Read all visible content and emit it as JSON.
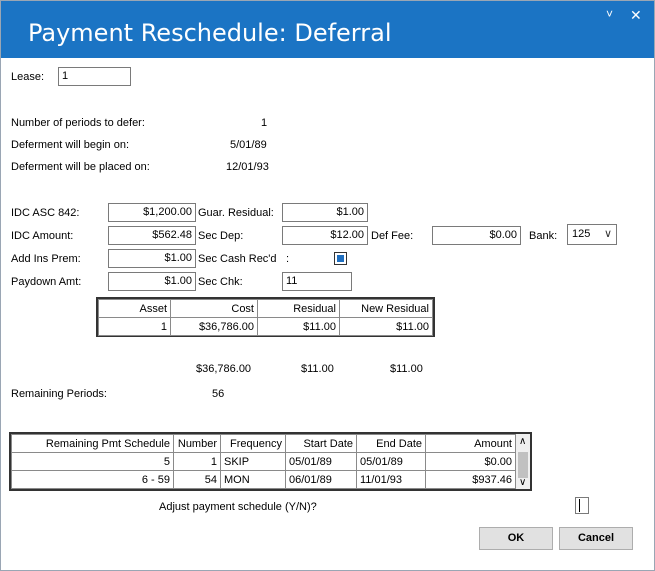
{
  "window": {
    "title": "Payment Reschedule: Deferral",
    "restore_glyph": "˅",
    "close_glyph": "✕"
  },
  "lease": {
    "label": "Lease:",
    "value": "1"
  },
  "info": {
    "periods_label": "Number of periods to defer:",
    "periods_value": "1",
    "begin_label": "Deferment will begin on:",
    "begin_value": "5/01/89",
    "placed_label": "Deferment will be placed on:",
    "placed_value": "12/01/93"
  },
  "fields": {
    "idc_asc_label": "IDC ASC 842:",
    "idc_asc_value": "$1,200.00",
    "idc_amount_label": "IDC Amount:",
    "idc_amount_value": "$562.48",
    "add_ins_label": "Add Ins Prem:",
    "add_ins_value": "$1.00",
    "paydown_label": "Paydown Amt:",
    "paydown_value": "$1.00",
    "guar_label": "Guar. Residual:",
    "guar_value": "$1.00",
    "sec_dep_label": "Sec Dep:",
    "sec_dep_value": "$12.00",
    "sec_cash_label": "Sec Cash Rec'd",
    "sec_cash_colon": ":",
    "sec_chk_label": "Sec Chk:",
    "sec_chk_value": "11",
    "def_fee_label": "Def Fee:",
    "def_fee_value": "$0.00",
    "bank_label": "Bank:",
    "bank_value": "125",
    "bank_chevron": "∨"
  },
  "asset_table": {
    "headers": [
      "Asset",
      "Cost",
      "Residual",
      "New Residual"
    ],
    "rows": [
      [
        "1",
        "$36,786.00",
        "$11.00",
        "$11.00"
      ]
    ]
  },
  "totals": {
    "cost": "$36,786.00",
    "residual": "$11.00",
    "new_residual": "$11.00"
  },
  "remaining": {
    "label": "Remaining Periods:",
    "value": "56"
  },
  "schedule_table": {
    "headers": [
      "Remaining Pmt Schedule",
      "Number",
      "Frequency",
      "Start Date",
      "End Date",
      "Amount"
    ],
    "rows": [
      [
        "5",
        "1",
        "SKIP",
        "05/01/89",
        "05/01/89",
        "$0.00"
      ],
      [
        "6 - 59",
        "54",
        "MON",
        "06/01/89",
        "11/01/93",
        "$937.46"
      ]
    ],
    "scroll_up": "∧",
    "scroll_down": "∨"
  },
  "adjust": {
    "label": "Adjust payment schedule (Y/N)?",
    "value": ""
  },
  "buttons": {
    "ok": "OK",
    "cancel": "Cancel"
  }
}
